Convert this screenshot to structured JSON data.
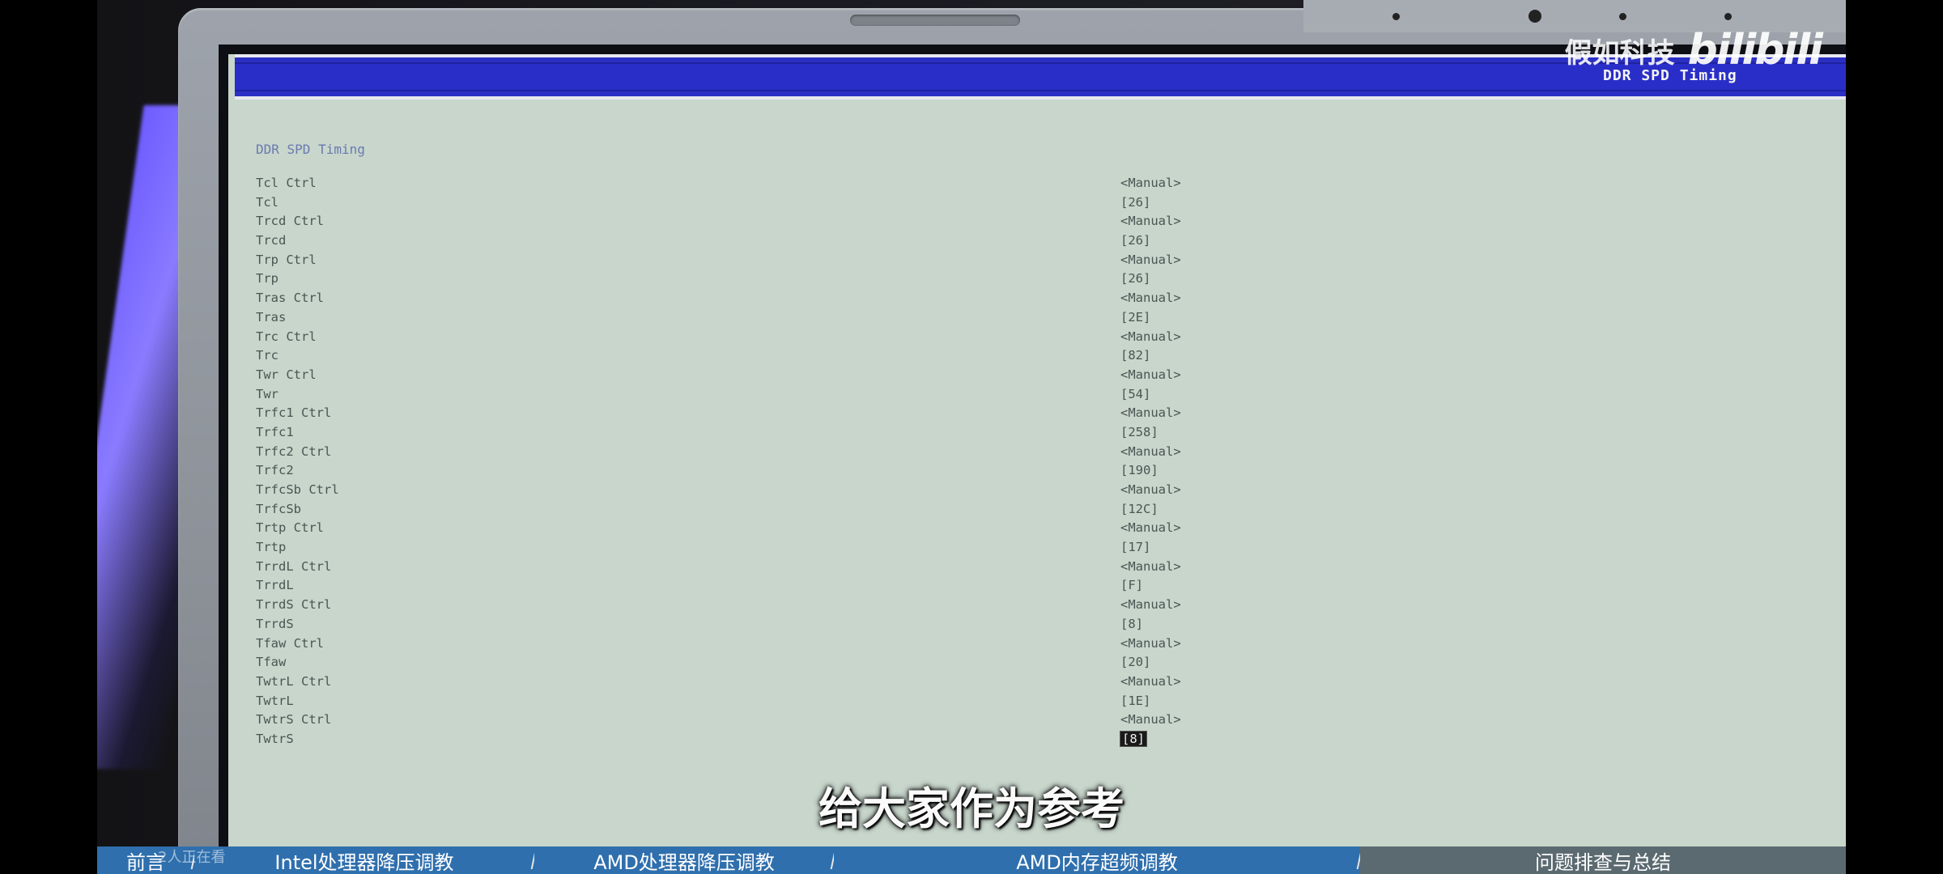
{
  "watermark": {
    "channel_name": "假如科技",
    "platform_logo": "bilibili"
  },
  "bios": {
    "header_title": "DDR SPD Timing",
    "section_title": "DDR SPD Timing",
    "settings": [
      {
        "label": "Tcl Ctrl",
        "value": "<Manual>"
      },
      {
        "label": "Tcl",
        "value": "[26]"
      },
      {
        "label": "Trcd Ctrl",
        "value": "<Manual>"
      },
      {
        "label": "Trcd",
        "value": "[26]"
      },
      {
        "label": "Trp Ctrl",
        "value": "<Manual>"
      },
      {
        "label": "Trp",
        "value": "[26]"
      },
      {
        "label": "Tras Ctrl",
        "value": "<Manual>"
      },
      {
        "label": "Tras",
        "value": "[2E]"
      },
      {
        "label": "Trc Ctrl",
        "value": "<Manual>"
      },
      {
        "label": "Trc",
        "value": "[82]"
      },
      {
        "label": "Twr Ctrl",
        "value": "<Manual>"
      },
      {
        "label": "Twr",
        "value": "[54]"
      },
      {
        "label": "Trfc1 Ctrl",
        "value": "<Manual>"
      },
      {
        "label": "Trfc1",
        "value": "[258]"
      },
      {
        "label": "Trfc2 Ctrl",
        "value": "<Manual>"
      },
      {
        "label": "Trfc2",
        "value": "[190]"
      },
      {
        "label": "TrfcSb Ctrl",
        "value": "<Manual>"
      },
      {
        "label": "TrfcSb",
        "value": "[12C]"
      },
      {
        "label": "Trtp Ctrl",
        "value": "<Manual>"
      },
      {
        "label": "Trtp",
        "value": "[17]"
      },
      {
        "label": "TrrdL Ctrl",
        "value": "<Manual>"
      },
      {
        "label": "TrrdL",
        "value": "[F]"
      },
      {
        "label": "TrrdS Ctrl",
        "value": "<Manual>"
      },
      {
        "label": "TrrdS",
        "value": "[8]"
      },
      {
        "label": "Tfaw Ctrl",
        "value": "<Manual>"
      },
      {
        "label": "Tfaw",
        "value": "[20]"
      },
      {
        "label": "TwtrL Ctrl",
        "value": "<Manual>"
      },
      {
        "label": "TwtrL",
        "value": "[1E]"
      },
      {
        "label": "TwtrS Ctrl",
        "value": "<Manual>"
      },
      {
        "label": "TwtrS",
        "value": "[8]",
        "selected": true
      }
    ]
  },
  "subtitle": "给大家作为参考",
  "viewers": "2人正在看",
  "chapters": [
    {
      "label": "前言",
      "state": "done"
    },
    {
      "label": "Intel处理器降压调教",
      "state": "done"
    },
    {
      "label": "AMD处理器降压调教",
      "state": "done"
    },
    {
      "label": "AMD内存超频调教",
      "state": "done"
    },
    {
      "label": "问题排查与总结",
      "state": "rest"
    }
  ],
  "colors": {
    "bios_background": "#c8d6cc",
    "bios_header": "#2a2ec8",
    "bios_text": "#4b5552",
    "chapter_done": "#2f6fad",
    "chapter_rest": "#5b6a70"
  }
}
